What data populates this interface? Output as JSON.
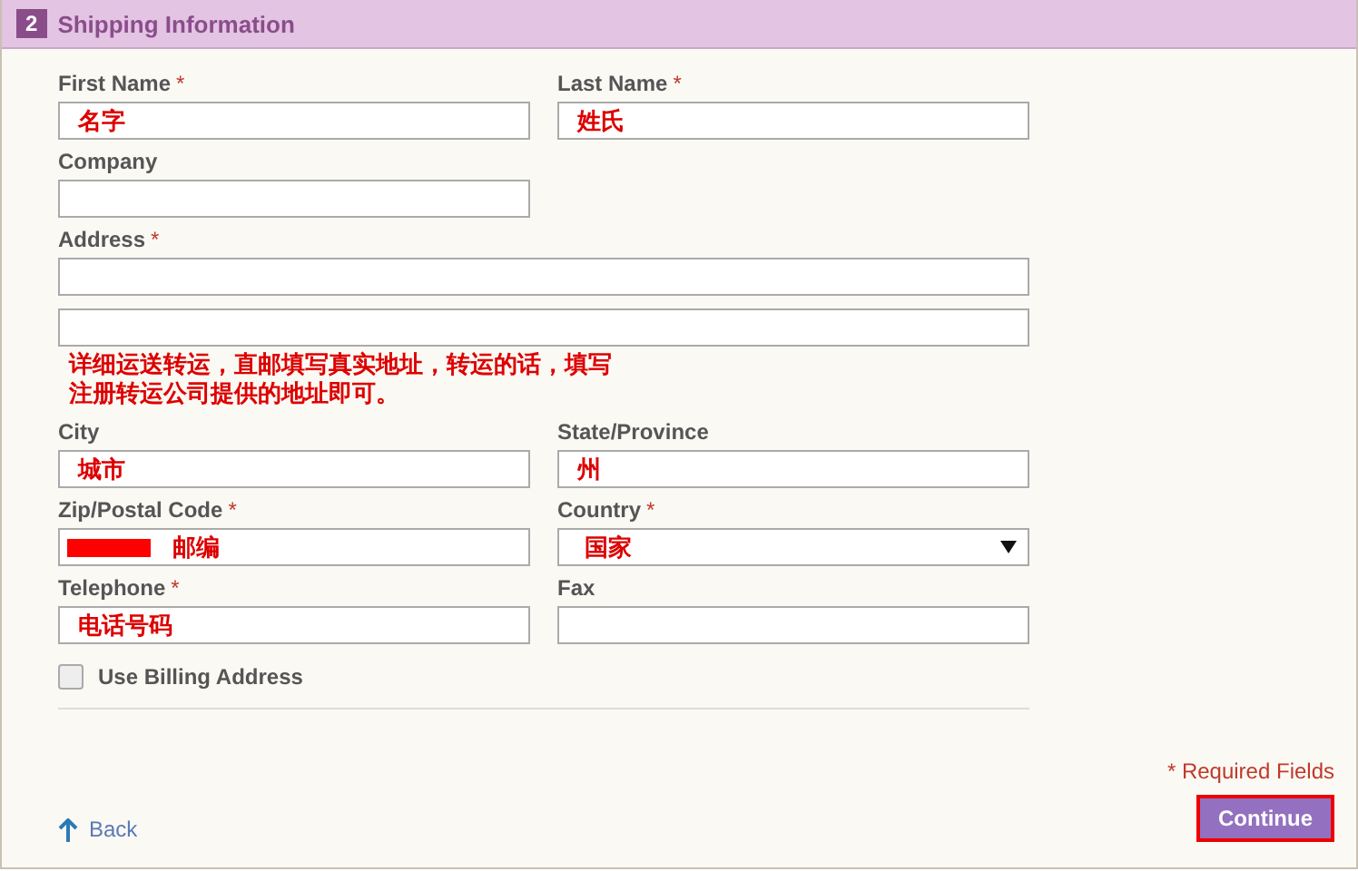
{
  "section": {
    "number": "2",
    "title": "Shipping Information"
  },
  "rows": [
    {
      "fields": [
        {
          "label": "First Name",
          "required_mark": "*",
          "kind": "text",
          "value": "名字"
        },
        {
          "label": "Last Name",
          "required_mark": "*",
          "kind": "text",
          "value": "姓氏"
        }
      ]
    },
    {
      "fields": [
        {
          "label": "Company",
          "kind": "text"
        }
      ]
    },
    {
      "fields": [
        {
          "label": "Address",
          "required_mark": "*",
          "kind": "address",
          "note": "详细运送转运，直邮填写真实地址，转运的话，填写注册转运公司提供的地址即可。"
        }
      ]
    },
    {
      "fields": [
        {
          "label": "City",
          "kind": "text",
          "value": "城市"
        },
        {
          "label": "State/Province",
          "kind": "text",
          "value": "州"
        }
      ]
    },
    {
      "fields": [
        {
          "label": "Zip/Postal Code",
          "required_mark": "*",
          "kind": "redacted",
          "value": "邮编"
        },
        {
          "label": "Country",
          "required_mark": "*",
          "kind": "select",
          "value": "国家"
        }
      ]
    },
    {
      "fields": [
        {
          "label": "Telephone",
          "required_mark": "*",
          "kind": "text",
          "value": "电话号码"
        },
        {
          "label": "Fax",
          "kind": "text"
        }
      ]
    }
  ],
  "use_billing": {
    "label": "Use Billing Address",
    "checked": false
  },
  "required_note": "* Required Fields",
  "back": "Back",
  "continue": "Continue"
}
